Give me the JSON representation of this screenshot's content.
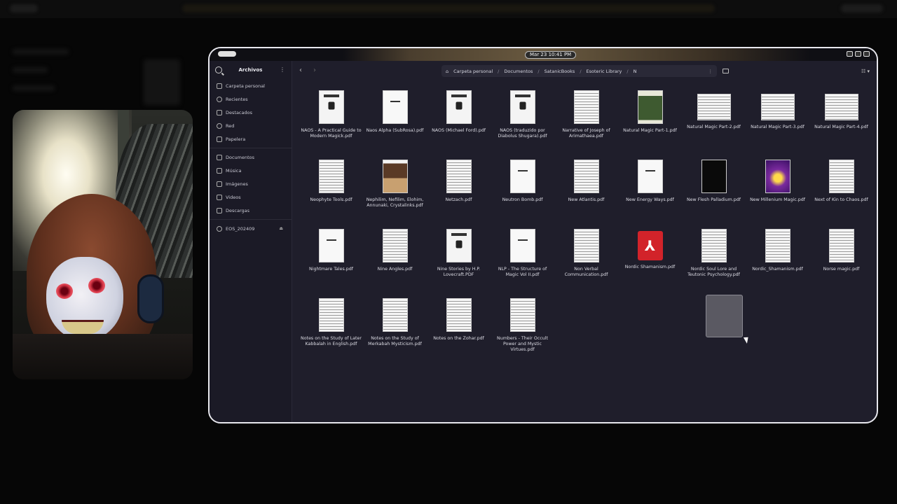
{
  "clock": "Mar 23  10:41 PM",
  "sidebar": {
    "title": "Archivos",
    "places": [
      {
        "label": "Carpeta personal",
        "icon": "home-icon"
      },
      {
        "label": "Recientes",
        "icon": "clock-icon"
      },
      {
        "label": "Destacados",
        "icon": "star-icon"
      },
      {
        "label": "Red",
        "icon": "network-icon"
      },
      {
        "label": "Papelera",
        "icon": "trash-icon"
      }
    ],
    "folders": [
      {
        "label": "Documentos",
        "icon": "document-icon"
      },
      {
        "label": "Música",
        "icon": "music-icon"
      },
      {
        "label": "Imágenes",
        "icon": "image-icon"
      },
      {
        "label": "Videos",
        "icon": "video-icon"
      },
      {
        "label": "Descargas",
        "icon": "download-icon"
      }
    ],
    "devices": [
      {
        "label": "EOS_202409",
        "icon": "drive-icon"
      }
    ]
  },
  "breadcrumbs": [
    "Carpeta personal",
    "Documentos",
    "SatanicBooks",
    "Esoteric Library",
    "N"
  ],
  "files": [
    {
      "name": "NAOS - A Practical Guide to Modern Magick.pdf",
      "thumb": "cover"
    },
    {
      "name": "Naos Alpha (SubRosa).pdf",
      "thumb": "blank"
    },
    {
      "name": "NAOS (Michael Ford).pdf",
      "thumb": "cover"
    },
    {
      "name": "NAOS (traduzido por Diabolus Shugara).pdf",
      "thumb": "cover"
    },
    {
      "name": "Narrative of Joseph of Arimathaea.pdf",
      "thumb": "lines"
    },
    {
      "name": "Natural Magic Part-1.pdf",
      "thumb": "green"
    },
    {
      "name": "Natural Magic Part-2.pdf",
      "thumb": "spread"
    },
    {
      "name": "Natural Magic Part-3.pdf",
      "thumb": "spread"
    },
    {
      "name": "Natural Magic Part-4.pdf",
      "thumb": "spread"
    },
    {
      "name": "Neophyte Tools.pdf",
      "thumb": "lines"
    },
    {
      "name": "Nephilim, Nefilim, Elohim, Annunaki, Crystalinks.pdf",
      "thumb": "brown"
    },
    {
      "name": "Netzach.pdf",
      "thumb": "lines"
    },
    {
      "name": "Neutron Bomb.pdf",
      "thumb": "blank"
    },
    {
      "name": "New Atlantis.pdf",
      "thumb": "lines"
    },
    {
      "name": "New Energy Ways.pdf",
      "thumb": "blank"
    },
    {
      "name": "New Flesh Palladium.pdf",
      "thumb": "dark"
    },
    {
      "name": "New Millenium Magic.pdf",
      "thumb": "purple"
    },
    {
      "name": "Next of Kin to Chaos.pdf",
      "thumb": "lines"
    },
    {
      "name": "Nightmare Tales.pdf",
      "thumb": "blank"
    },
    {
      "name": "Nine Angles.pdf",
      "thumb": "lines"
    },
    {
      "name": "Nine Stories by H.P. Lovecraft.PDF",
      "thumb": "cover"
    },
    {
      "name": "NLP - The Structure of Magic Vol II.pdf",
      "thumb": "blank"
    },
    {
      "name": "Non Verbal Communication.pdf",
      "thumb": "lines"
    },
    {
      "name": "Nordic Shamanism.pdf",
      "thumb": "pdf"
    },
    {
      "name": "Nordic Soul Lore and Teutonic Psychology.pdf",
      "thumb": "lines"
    },
    {
      "name": "Nordic_Shamanism.pdf",
      "thumb": "lines"
    },
    {
      "name": "Norse magic.pdf",
      "thumb": "lines"
    },
    {
      "name": "Notes on the Study of Later Kabbalah in English.pdf",
      "thumb": "lines"
    },
    {
      "name": "Notes on the Study of Merkabah Mysticism.pdf",
      "thumb": "lines"
    },
    {
      "name": "Notes on the Zohar.pdf",
      "thumb": "lines"
    },
    {
      "name": "Numbers - Their Occult Power and Mystic Virtues.pdf",
      "thumb": "lines"
    }
  ]
}
